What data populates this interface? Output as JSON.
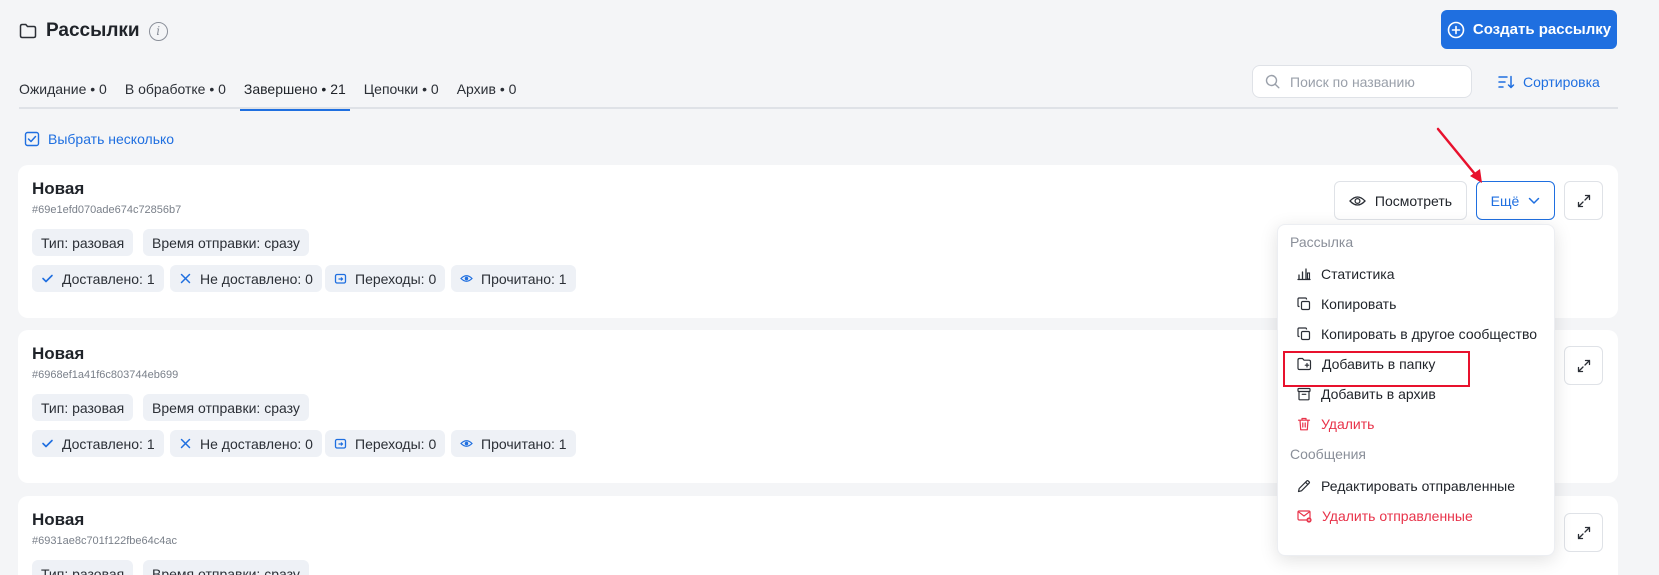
{
  "header": {
    "title": "Рассылки",
    "info_glyph": "i",
    "create_label": "Создать рассылку"
  },
  "tabs": [
    {
      "label": "Ожидание • 0"
    },
    {
      "label": "В обработке • 0"
    },
    {
      "label": "Завершено • 21",
      "active": true
    },
    {
      "label": "Цепочки • 0"
    },
    {
      "label": "Архив • 0"
    }
  ],
  "search": {
    "placeholder": "Поиск по названию",
    "value": ""
  },
  "sort_label": "Сортировка",
  "select_many_label": "Выбрать несколько",
  "cards": [
    {
      "title": "Новая",
      "id": "#69e1efd070ade674c72856b7",
      "type": "Тип: разовая",
      "send_time": "Время отправки: сразу",
      "delivered": "Доставлено: 1",
      "not_delivered": "Не доставлено: 0",
      "clicks": "Переходы: 0",
      "read": "Прочитано: 1"
    },
    {
      "title": "Новая",
      "id": "#6968ef1a41f6c803744eb699",
      "type": "Тип: разовая",
      "send_time": "Время отправки: сразу",
      "delivered": "Доставлено: 1",
      "not_delivered": "Не доставлено: 0",
      "clicks": "Переходы: 0",
      "read": "Прочитано: 1"
    },
    {
      "title": "Новая",
      "id": "#6931ae8c701f122fbe64c4ac",
      "type": "Тип: разовая",
      "send_time": "Время отправки: сразу"
    }
  ],
  "actions": {
    "view_label": "Посмотреть",
    "more_label": "Ещё"
  },
  "dropdown": {
    "section1": "Рассылка",
    "items1": [
      {
        "label": "Статистика",
        "icon": "chart-icon"
      },
      {
        "label": "Копировать",
        "icon": "copy-icon"
      },
      {
        "label": "Копировать в другое сообщество",
        "icon": "copy-icon"
      },
      {
        "label": "Добавить в папку",
        "icon": "folder-plus-icon",
        "highlighted": true
      },
      {
        "label": "Добавить в архив",
        "icon": "archive-icon"
      },
      {
        "label": "Удалить",
        "icon": "trash-icon",
        "danger": true
      }
    ],
    "section2": "Сообщения",
    "items2": [
      {
        "label": "Редактировать отправленные",
        "icon": "pencil-icon"
      },
      {
        "label": "Удалить отправленные",
        "icon": "mail-delete-icon",
        "danger": true
      }
    ]
  },
  "colors": {
    "accent": "#1f6fe0",
    "danger": "#e8334a",
    "annotation": "#e8112d",
    "background": "#f4f5f7"
  }
}
